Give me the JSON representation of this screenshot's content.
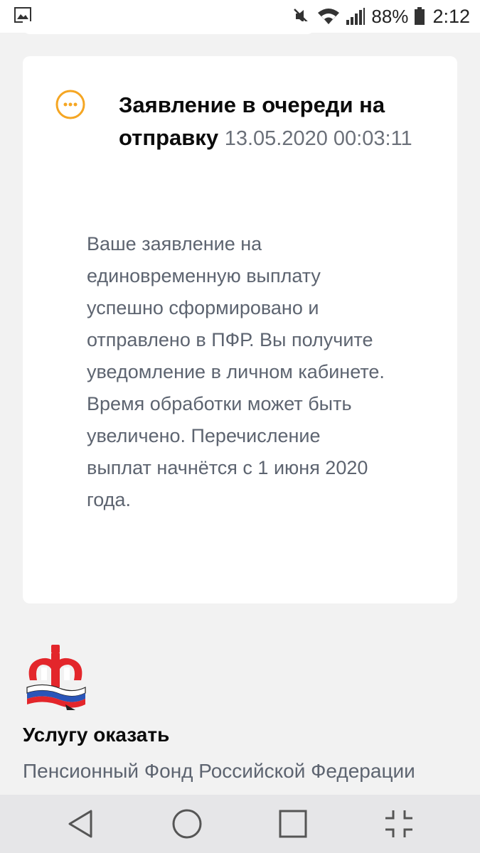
{
  "status_bar": {
    "battery": "88%",
    "time": "2:12",
    "icons": [
      "image-icon",
      "mute-icon",
      "wifi-icon",
      "signal-icon",
      "battery-icon"
    ]
  },
  "card": {
    "status_icon": "more-dots-icon",
    "status_color": "#f5a623",
    "title": "Заявление в очереди на отправку",
    "timestamp": "13.05.2020 00:03:11",
    "body": "Ваше заявление на единовременную выплату успешно сформировано и отправлено в ПФР. Вы получите уведомление в личном кабинете. Время обработки может быть увеличено. Перечисление выплат начнётся с 1 июня 2020 года."
  },
  "provider": {
    "logo": "pfr-logo",
    "label": "Услугу оказать",
    "name": "Пенсионный Фонд Российской Федерации"
  },
  "navbar": {
    "buttons": [
      "back-icon",
      "home-icon",
      "recents-icon",
      "fullscreen-exit-icon"
    ]
  }
}
